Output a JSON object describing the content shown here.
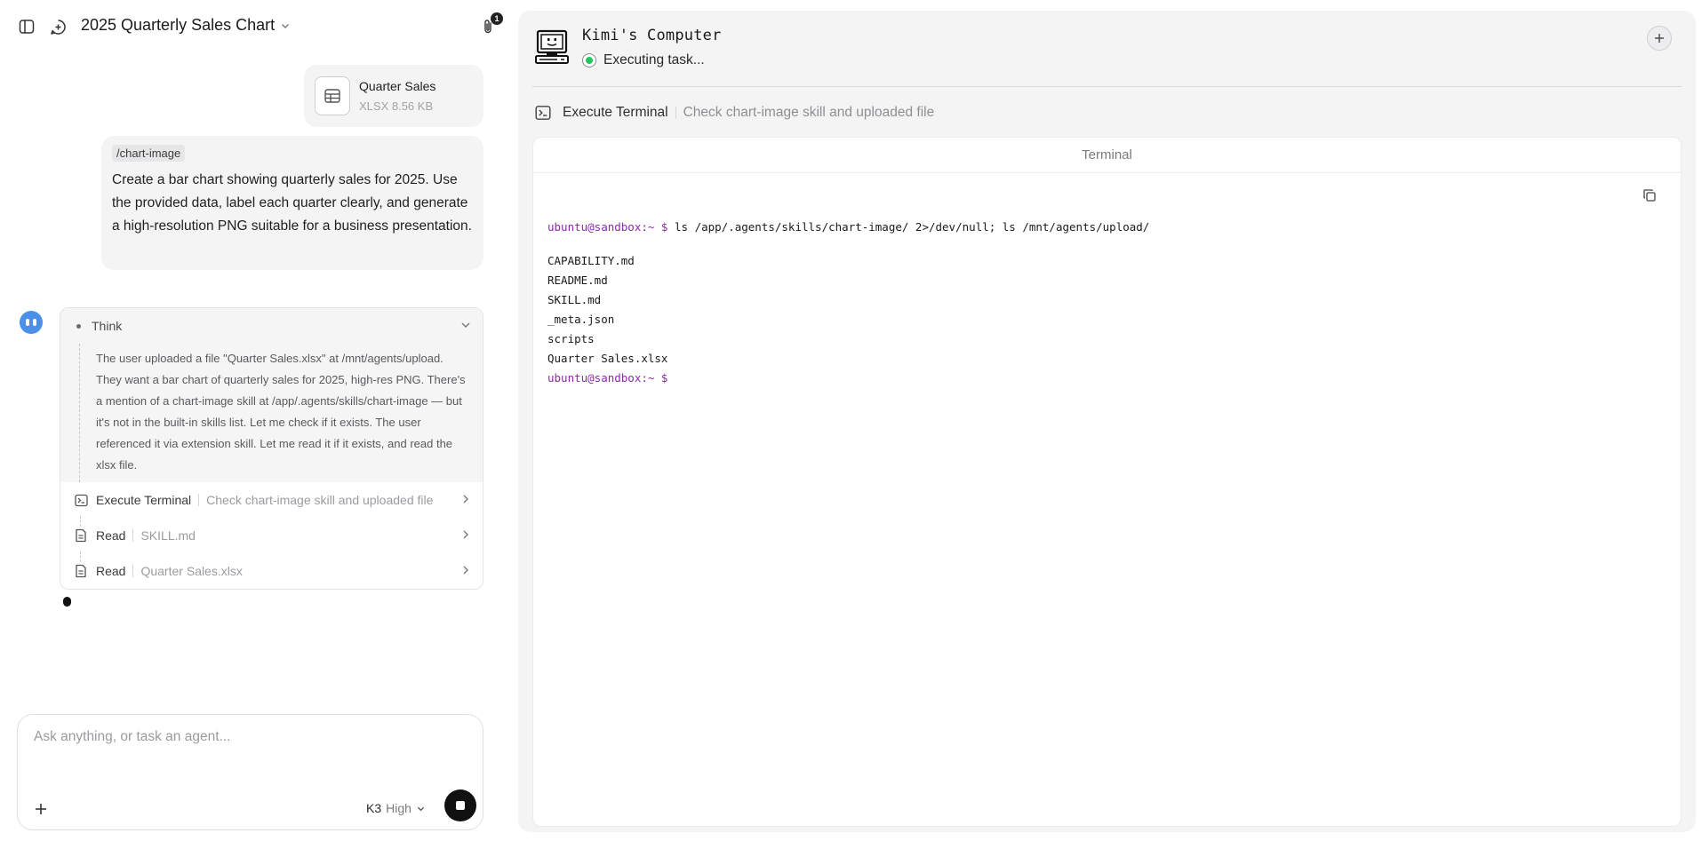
{
  "header": {
    "title": "2025 Quarterly Sales Chart",
    "attachment_count": "1"
  },
  "attachment": {
    "name": "Quarter Sales",
    "meta": "XLSX 8.56 KB"
  },
  "user_message": {
    "command": "/chart-image",
    "text": "Create a bar chart showing quarterly sales for 2025. Use the provided data, label each quarter clearly, and generate a high-resolution PNG suitable for a business presentation."
  },
  "steps": {
    "think_label": "Think",
    "think_text": "The user uploaded a file \"Quarter Sales.xlsx\" at /mnt/agents/upload. They want a bar chart of quarterly sales for 2025, high-res PNG. There's a mention of a chart-image skill at /app/.agents/skills/chart-image — but it's not in the built-in skills list. Let me check if it exists. The user referenced it via extension skill. Let me read it if it exists, and read the xlsx file.",
    "items": [
      {
        "label": "Execute Terminal",
        "desc": "Check chart-image skill and uploaded file"
      },
      {
        "label": "Read",
        "desc": "SKILL.md"
      },
      {
        "label": "Read",
        "desc": "Quarter Sales.xlsx"
      }
    ]
  },
  "composer": {
    "placeholder": "Ask anything, or task an agent...",
    "model": "K3",
    "level": "High"
  },
  "computer": {
    "title": "Kimi's Computer",
    "status": "Executing task...",
    "exec_label": "Execute Terminal",
    "exec_desc": "Check chart-image skill and uploaded file",
    "terminal_title": "Terminal",
    "prompt": "ubuntu@sandbox:~ $",
    "command": "ls /app/.agents/skills/chart-image/ 2>/dev/null; ls /mnt/agents/upload/",
    "output": [
      "CAPABILITY.md",
      "README.md",
      "SKILL.md",
      "_meta.json",
      "scripts",
      "Quarter Sales.xlsx"
    ]
  },
  "colors": {
    "prompt": "#8a2aa8",
    "status_green": "#22c55e",
    "avatar_blue": "#4a90e8"
  }
}
